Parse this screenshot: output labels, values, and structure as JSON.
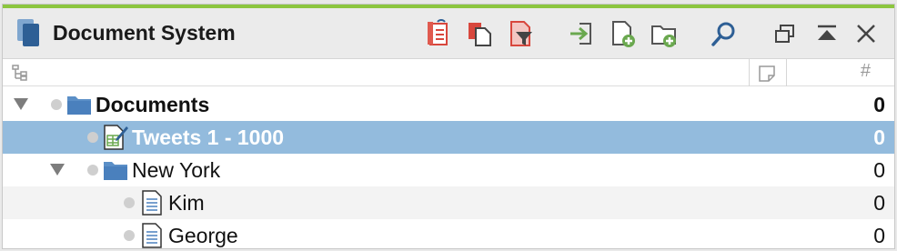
{
  "window": {
    "title": "Document System",
    "accent_color": "#8cc63f",
    "selection_color": "#93bbdd"
  },
  "toolbar": {
    "buttons": [
      {
        "icon": "document-refresh-icon"
      },
      {
        "icon": "copy-document-icon"
      },
      {
        "icon": "filter-document-icon"
      },
      {
        "icon": "import-icon"
      },
      {
        "icon": "new-document-icon"
      },
      {
        "icon": "new-folder-icon"
      },
      {
        "icon": "search-icon"
      },
      {
        "icon": "undock-window-icon"
      },
      {
        "icon": "collapse-panel-icon"
      },
      {
        "icon": "close-icon"
      }
    ]
  },
  "columns": {
    "tree_icon": "tree-structure-icon",
    "memo_icon": "memo-icon",
    "count_header": "#"
  },
  "tree": [
    {
      "label": "Documents",
      "count": "0",
      "type": "folder",
      "depth": 0,
      "expanded": true,
      "bold": true,
      "selected": false
    },
    {
      "label": "Tweets 1 - 1000",
      "count": "0",
      "type": "table-document",
      "depth": 1,
      "expanded": null,
      "bold": true,
      "selected": true
    },
    {
      "label": "New York",
      "count": "0",
      "type": "folder",
      "depth": 1,
      "expanded": true,
      "bold": false,
      "selected": false
    },
    {
      "label": "Kim",
      "count": "0",
      "type": "text-document",
      "depth": 2,
      "expanded": null,
      "bold": false,
      "selected": false
    },
    {
      "label": "George",
      "count": "0",
      "type": "text-document",
      "depth": 2,
      "expanded": null,
      "bold": false,
      "selected": false
    }
  ]
}
